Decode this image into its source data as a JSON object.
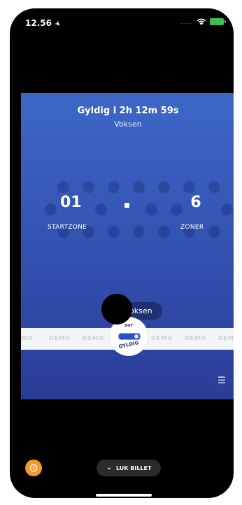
{
  "status_bar": {
    "time": "12.56",
    "location_icon": "location-arrow-icon",
    "signal": ".....",
    "wifi_icon": "wifi-icon",
    "battery_icon": "battery-icon"
  },
  "ticket": {
    "valid_text": "Gyldig i 2h 12m 59s",
    "passenger_type": "Voksen",
    "start_zone_value": "01",
    "start_zone_label": "STARTZONE",
    "zones_value": "6",
    "zones_label": "ZONER",
    "type_pill_label": "Voksen",
    "demo_words": [
      "DEMO",
      "DEMO",
      "DEMO",
      "DEMO",
      "DEMO",
      "DEMO"
    ],
    "badge_top": "DOT",
    "badge_bottom": "GYLDIG",
    "menu_icon": "menu-icon"
  },
  "footer": {
    "clock_icon": "clock-icon",
    "close_button_label": "LUK BILLET",
    "chevron_icon": "chevron-down-icon"
  },
  "colors": {
    "ticket_top": "#3d67c7",
    "ticket_bottom": "#2a3c97",
    "accent_orange": "#f5992a",
    "battery_green": "#3fbf4f"
  }
}
